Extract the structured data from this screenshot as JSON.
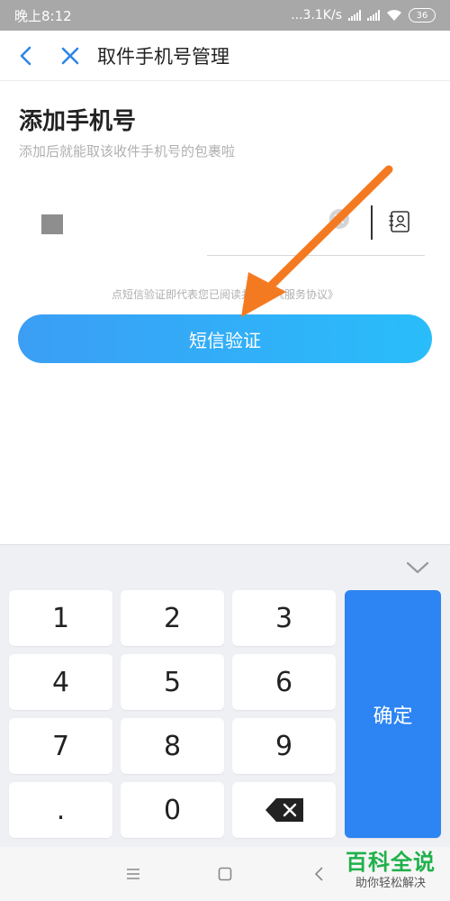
{
  "status_bar": {
    "time": "晚上8:12",
    "network_speed": "...3.1K/s",
    "battery": "36"
  },
  "header": {
    "title": "取件手机号管理"
  },
  "main": {
    "title": "添加手机号",
    "subtitle": "添加后就能取该收件手机号的包裹啦",
    "phone_input_value": "",
    "agreement_text": "点短信验证即代表您已阅读并同意",
    "agreement_link": "《服务协议》",
    "sms_button_label": "短信验证"
  },
  "keyboard": {
    "keys": [
      "1",
      "2",
      "3",
      "4",
      "5",
      "6",
      "7",
      "8",
      "9",
      ".",
      "0"
    ],
    "confirm_label": "确定"
  },
  "watermark": {
    "main": "百科全说",
    "sub": "助你轻松解决"
  },
  "colors": {
    "accent": "#2d84f3",
    "button_gradient_start": "#3b9ef5",
    "button_gradient_end": "#29bdfa",
    "arrow": "#f47a21",
    "watermark_green": "#1fb14a"
  }
}
